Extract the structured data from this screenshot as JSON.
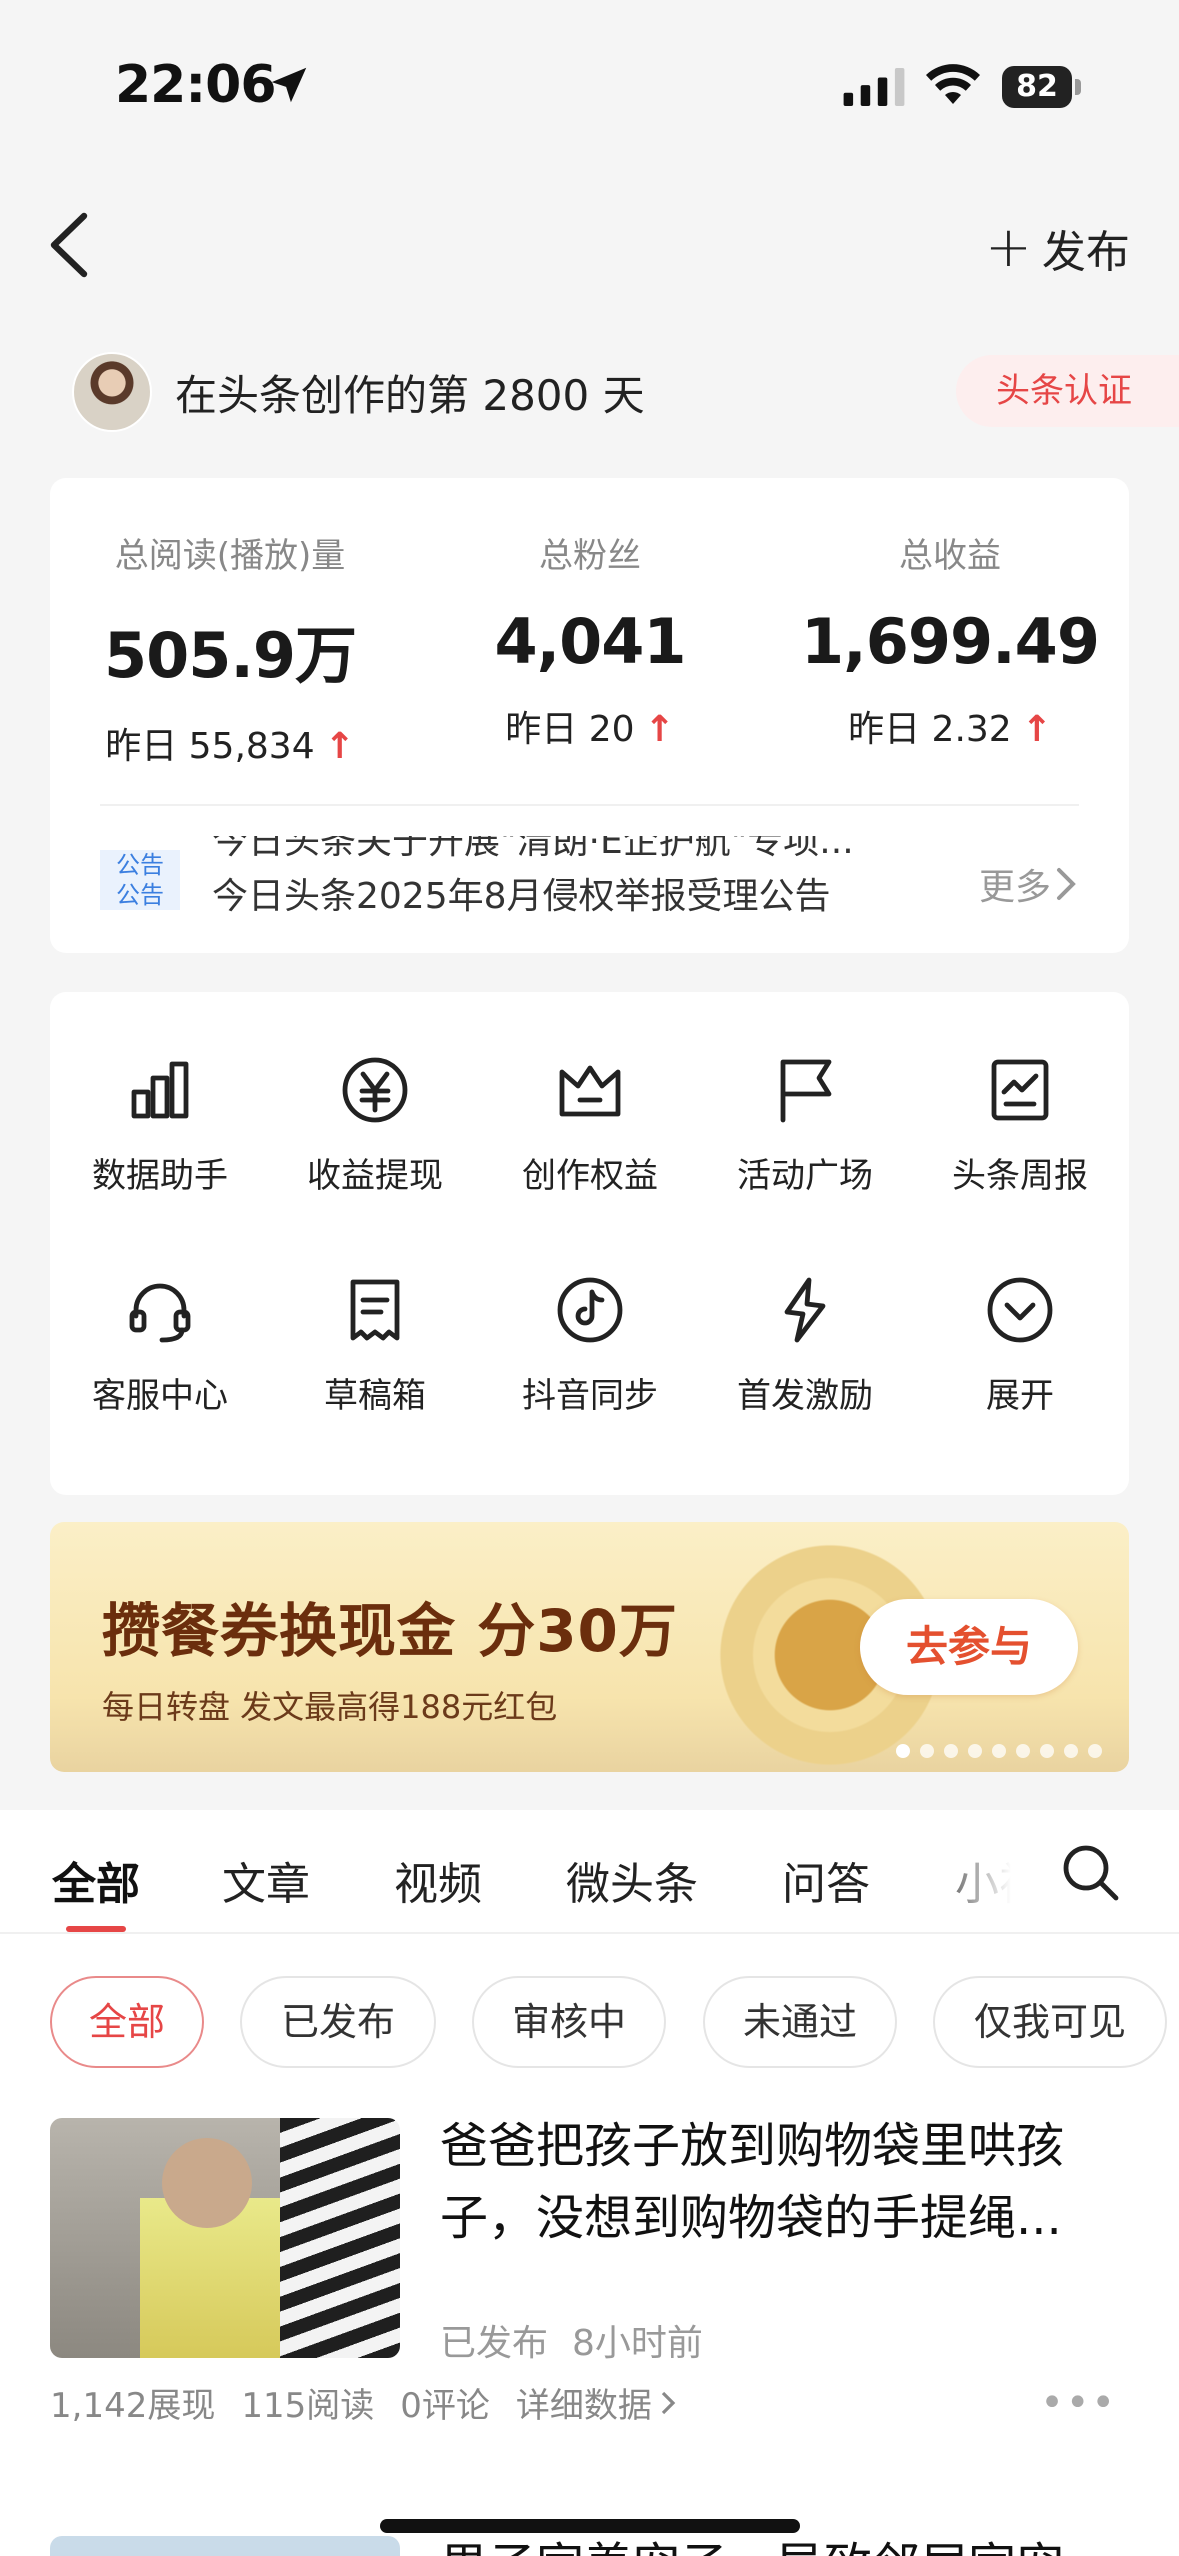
{
  "status_bar": {
    "time": "22:06",
    "battery": "82"
  },
  "nav": {
    "publish_label": "发布",
    "publish_plus": "+"
  },
  "profile": {
    "creation_text": "在头条创作的第 2800 天",
    "cert_badge": "头条认证"
  },
  "stats": [
    {
      "label": "总阅读(播放)量",
      "value": "505.9万",
      "delta": "昨日 55,834"
    },
    {
      "label": "总粉丝",
      "value": "4,041",
      "delta": "昨日 20"
    },
    {
      "label": "总收益",
      "value": "1,699.49",
      "delta": "昨日 2.32"
    }
  ],
  "notice": {
    "tag": "公告",
    "line1": "今日头条关于开展\"清朗·E企护航\"专项...",
    "line2": "今日头条2025年8月侵权举报受理公告",
    "more": "更多"
  },
  "tools": [
    {
      "label": "数据助手",
      "icon": "bar-chart-icon"
    },
    {
      "label": "收益提现",
      "icon": "yuan-coin-icon"
    },
    {
      "label": "创作权益",
      "icon": "crown-icon"
    },
    {
      "label": "活动广场",
      "icon": "flag-icon"
    },
    {
      "label": "头条周报",
      "icon": "report-chart-icon"
    },
    {
      "label": "客服中心",
      "icon": "headset-icon"
    },
    {
      "label": "草稿箱",
      "icon": "draft-icon"
    },
    {
      "label": "抖音同步",
      "icon": "douyin-icon"
    },
    {
      "label": "首发激励",
      "icon": "lightning-icon"
    },
    {
      "label": "展开",
      "icon": "chevron-down-circle-icon"
    }
  ],
  "banner": {
    "title": "攒餐券换现金 分30万",
    "subtitle": "每日转盘 发文最高得188元红包",
    "button": "去参与"
  },
  "content_tabs": [
    {
      "label": "全部",
      "active": true
    },
    {
      "label": "文章",
      "active": false
    },
    {
      "label": "视频",
      "active": false
    },
    {
      "label": "微头条",
      "active": false
    },
    {
      "label": "问答",
      "active": false
    },
    {
      "label": "小视",
      "active": false
    }
  ],
  "filter_chips": [
    {
      "label": "全部",
      "active": true
    },
    {
      "label": "已发布",
      "active": false
    },
    {
      "label": "审核中",
      "active": false
    },
    {
      "label": "未通过",
      "active": false
    },
    {
      "label": "仅我可见",
      "active": false
    }
  ],
  "articles": [
    {
      "title": "爸爸把孩子放到购物袋里哄孩子，没想到购物袋的手提绳...",
      "status": "已发布",
      "time": "8小时前",
      "impressions": "1,142展现",
      "reads": "115阅读",
      "comments": "0评论",
      "detail_link": "详细数据"
    },
    {
      "title": "男子家养宠子，导致邻居家宠"
    }
  ],
  "colors": {
    "accent": "#e64646",
    "banner_title": "#6b2e0d",
    "notice_tag": "#3b7fe0"
  }
}
